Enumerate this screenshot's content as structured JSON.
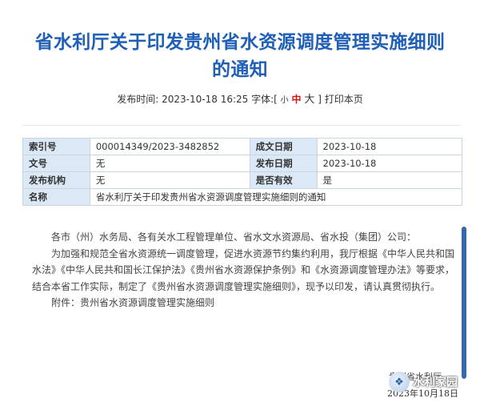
{
  "article": {
    "title_line1": "省水利厅关于印发贵州省水资源调度管理实施细则",
    "title_line2": "的通知"
  },
  "meta": {
    "publish_label": "发布时间:",
    "publish_time": "2023-10-18 16:25",
    "font_label": "字体:[",
    "font_small": "小",
    "font_medium": "中",
    "font_large": "大",
    "font_close": "]",
    "print_label": "打印本页"
  },
  "info_table": {
    "index_label": "索引号",
    "index_value": "000014349/2023-3482852",
    "created_label": "成文日期",
    "created_value": "2023-10-18",
    "doc_no_label": "文号",
    "doc_no_value": "无",
    "pub_date_label": "发布日期",
    "pub_date_value": "2023-10-18",
    "issuer_label": "发布机构",
    "issuer_value": "无",
    "valid_label": "是否有效",
    "valid_value": "是",
    "name_label": "名称",
    "name_value": "省水利厅关于印发贵州省水资源调度管理实施细则的通知"
  },
  "body": {
    "salutation": "各市（州）水务局、各有关水工程管理单位、省水文水资源局、省水投（集团）公司：",
    "paragraph": "为加强和规范全省水资源统一调度管理，促进水资源节约集约利用，我厅根据《中华人民共和国水法》《中华人民共和国长江保护法》《贵州省水资源保护条例》和《水资源调度管理办法》等要求，结合本省工作实际，制定了《贵州省水资源调度管理实施细则》，现予以印发，请认真贯彻执行。",
    "attachment": "附件：贵州省水资源调度管理实施细则",
    "signature": "贵州省水利厅",
    "sign_date": "2023年10月18日"
  },
  "watermark": {
    "text": "水利家园",
    "icon": "wechat-logo-icon"
  },
  "colors": {
    "title": "#1f5fb8",
    "table_header": "#dbe8f6",
    "scroll_thumb": "#3567b0",
    "font_medium": "#dd1111"
  }
}
